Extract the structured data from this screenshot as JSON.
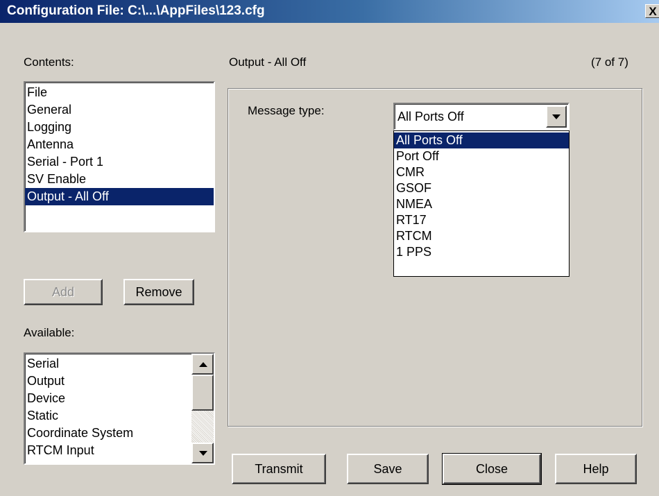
{
  "window": {
    "title": "Configuration File: C:\\...\\AppFiles\\123.cfg",
    "close_label": "X"
  },
  "contents": {
    "label": "Contents:",
    "items": [
      "File",
      "General",
      "Logging",
      "Antenna",
      "Serial - Port 1",
      "SV Enable",
      "Output - All Off"
    ],
    "selected_index": 6
  },
  "buttons": {
    "add_label": "Add",
    "remove_label": "Remove",
    "transmit_label": "Transmit",
    "save_label": "Save",
    "close_label": "Close",
    "help_label": "Help"
  },
  "available": {
    "label": "Available:",
    "items": [
      "Serial",
      "Output",
      "Device",
      "Static",
      "Coordinate System",
      "RTCM Input"
    ]
  },
  "panel": {
    "heading": "Output - All Off",
    "counter": "(7 of 7)"
  },
  "message_type": {
    "label": "Message type:",
    "value": "All Ports Off",
    "options": [
      "All Ports Off",
      "Port Off",
      "CMR",
      "GSOF",
      "NMEA",
      "RT17",
      "RTCM",
      "1 PPS"
    ],
    "selected_index": 0
  },
  "colors": {
    "title_gradient_start": "#0a246a",
    "title_gradient_end": "#a6caf0",
    "selection": "#0a246a",
    "dialog_bg": "#d4d0c8"
  }
}
